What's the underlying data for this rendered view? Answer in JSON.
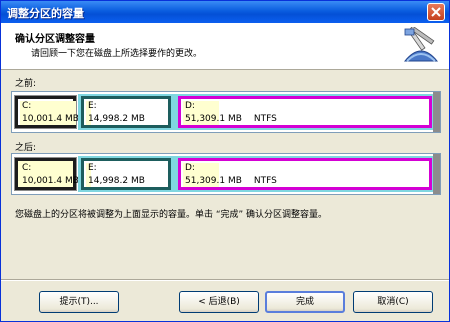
{
  "window": {
    "title": "调整分区的容量"
  },
  "header": {
    "title": "确认分区调整容量",
    "subtitle": "请回顾一下您在磁盘上所选择要作的更改。"
  },
  "before": {
    "label": "之前:",
    "partitions": [
      {
        "name": "C:",
        "size": "10,001.4 MB",
        "fs": ""
      },
      {
        "name": "E:",
        "size": "14,998.2 MB",
        "fs": ""
      },
      {
        "name": "D:",
        "size": "51,309.1 MB",
        "fs": "NTFS"
      }
    ]
  },
  "after": {
    "label": "之后:",
    "partitions": [
      {
        "name": "C:",
        "size": "10,001.4 MB",
        "fs": ""
      },
      {
        "name": "E:",
        "size": "14,998.2 MB",
        "fs": ""
      },
      {
        "name": "D:",
        "size": "51,309.1 MB",
        "fs": "NTFS"
      }
    ]
  },
  "note": "您磁盘上的分区将被调整为上面显示的容量。单击 “完成” 确认分区调整容量。",
  "buttons": {
    "hints": "提示(T)...",
    "back": "< 后退(B)",
    "finish": "完成",
    "cancel": "取消(C)"
  },
  "colors": {
    "titlebar": "#0a5ddf",
    "partition_c_border": "#1c1c1c",
    "partition_e_border": "#1d5d5d",
    "partition_d_border": "#d400d4",
    "selection_highlight": "#7fd6e0",
    "used_space": "#ffffd0"
  }
}
